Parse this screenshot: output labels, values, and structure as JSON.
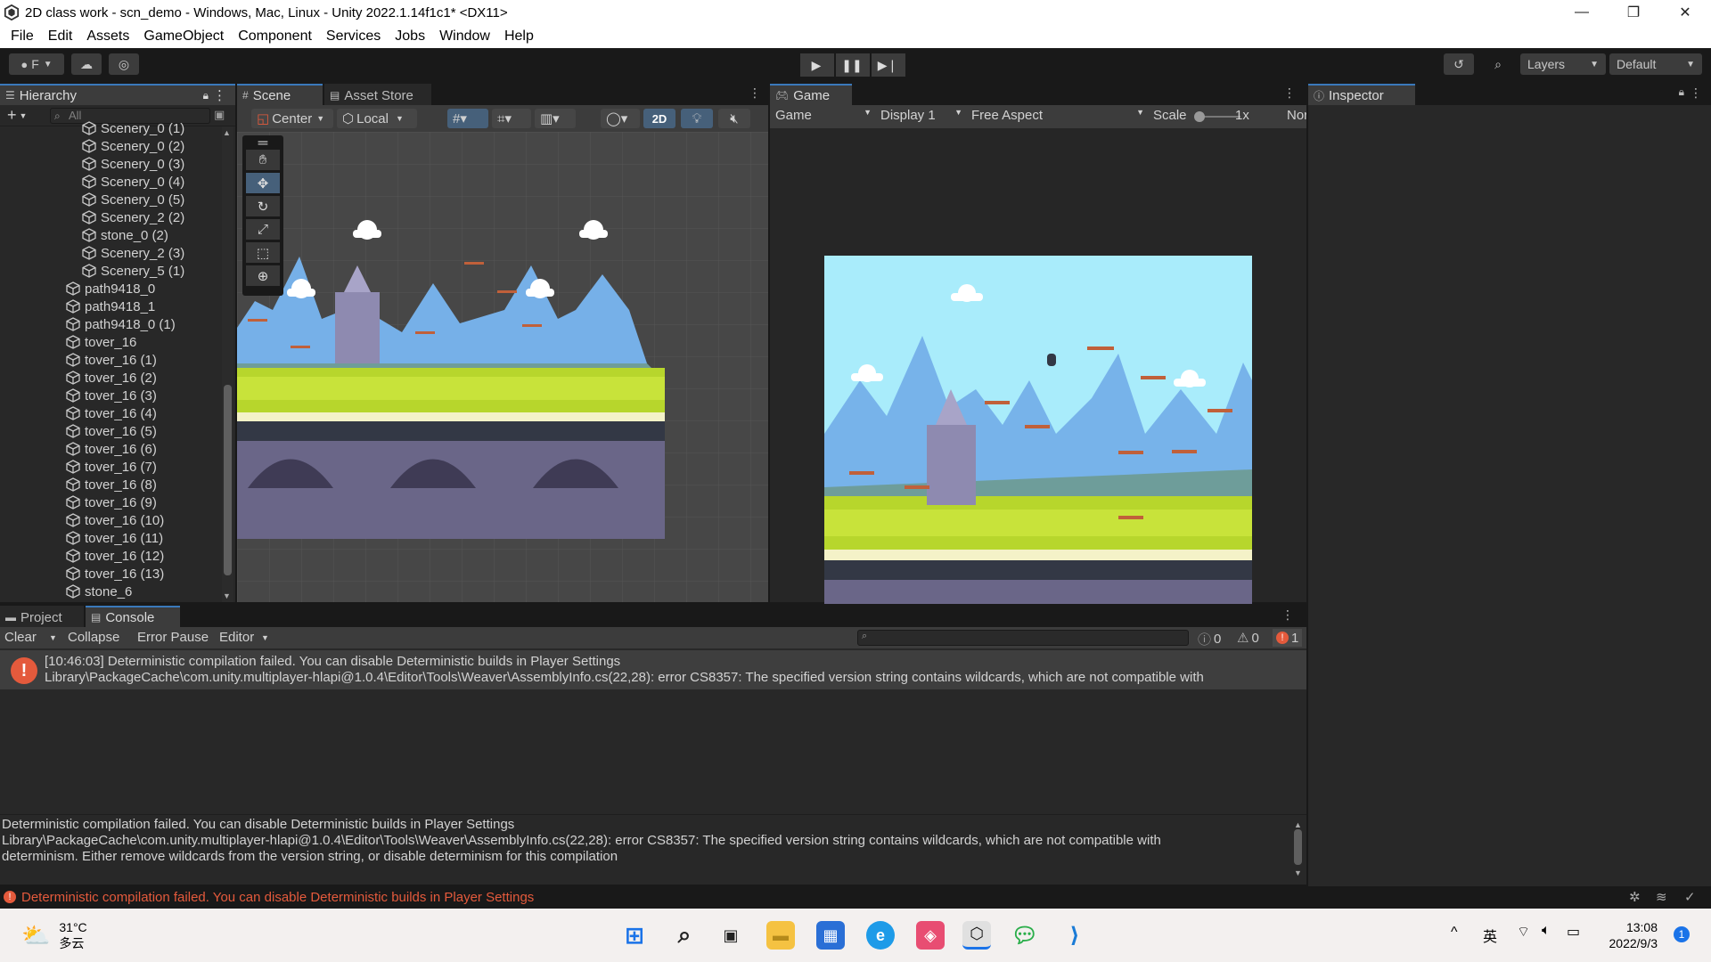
{
  "window": {
    "title": "2D class work - scn_demo - Windows, Mac, Linux - Unity 2022.1.14f1c1* <DX11>",
    "controls": [
      "—",
      "❐",
      "✕"
    ]
  },
  "menu": [
    "File",
    "Edit",
    "Assets",
    "GameObject",
    "Component",
    "Services",
    "Jobs",
    "Window",
    "Help"
  ],
  "toolbar": {
    "account_label": "F",
    "layers_label": "Layers",
    "layout_label": "Default"
  },
  "hierarchy": {
    "tab_label": "Hierarchy",
    "search_placeholder": "All",
    "items_nested": [
      "Scenery_0 (1)",
      "Scenery_0 (2)",
      "Scenery_0 (3)",
      "Scenery_0 (4)",
      "Scenery_0 (5)",
      "Scenery_2 (2)",
      "stone_0 (2)",
      "Scenery_2 (3)",
      "Scenery_5 (1)"
    ],
    "items_top": [
      "path9418_0",
      "path9418_1",
      "path9418_0 (1)",
      "tover_16",
      "tover_16 (1)",
      "tover_16 (2)",
      "tover_16 (3)",
      "tover_16 (4)",
      "tover_16 (5)",
      "tover_16 (6)",
      "tover_16 (7)",
      "tover_16 (8)",
      "tover_16 (9)",
      "tover_16 (10)",
      "tover_16 (11)",
      "tover_16 (12)",
      "tover_16 (13)",
      "stone_6"
    ]
  },
  "scene": {
    "tab_label": "Scene",
    "asset_store_label": "Asset Store",
    "pivot_label": "Center",
    "space_label": "Local",
    "mode_2d_label": "2D"
  },
  "game": {
    "tab_label": "Game",
    "view_label": "Game",
    "display_label": "Display 1",
    "aspect_label": "Free Aspect",
    "scale_label": "Scale",
    "scale_value": "1x",
    "trailing_label": "Nor"
  },
  "inspector": {
    "tab_label": "Inspector"
  },
  "bottom_tabs": {
    "project_label": "Project",
    "console_label": "Console"
  },
  "console": {
    "clear_label": "Clear",
    "collapse_label": "Collapse",
    "error_pause_label": "Error Pause",
    "editor_label": "Editor",
    "log_count": "0",
    "warning_count": "0",
    "error_count": "1",
    "entry_line1": "[10:46:03] Deterministic compilation failed. You can disable Deterministic builds in Player Settings",
    "entry_line2": "Library\\PackageCache\\com.unity.multiplayer-hlapi@1.0.4\\Editor\\Tools\\Weaver\\AssemblyInfo.cs(22,28): error CS8357: The specified version string contains wildcards, which are not compatible with",
    "detail_line1": "Deterministic compilation failed. You can disable Deterministic builds in Player Settings",
    "detail_line2": "Library\\PackageCache\\com.unity.multiplayer-hlapi@1.0.4\\Editor\\Tools\\Weaver\\AssemblyInfo.cs(22,28): error CS8357: The specified version string contains wildcards, which are not compatible with",
    "detail_line3": "determinism. Either remove wildcards from the version string, or disable determinism for this compilation"
  },
  "status_bar": {
    "message": "Deterministic compilation failed. You can disable Deterministic builds in Player Settings"
  },
  "taskbar": {
    "weather_temp": "31°C",
    "weather_desc": "多云",
    "ime_label": "英",
    "time": "13:08",
    "date": "2022/9/3",
    "notification_count": "1"
  },
  "colors": {
    "accent": "#3a79bb",
    "error": "#e45a3c",
    "panel": "#282828",
    "toolbar": "#3c3c3c"
  }
}
